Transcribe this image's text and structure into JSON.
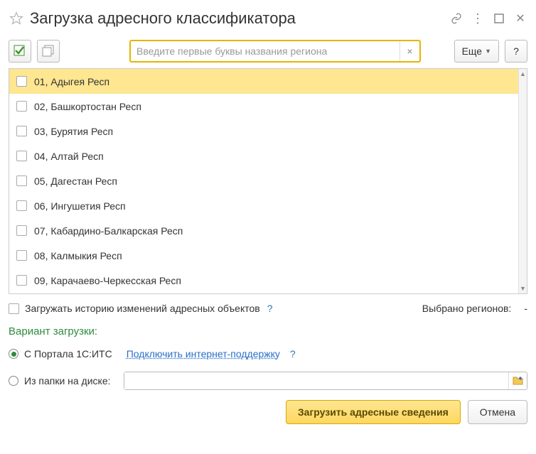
{
  "title": "Загрузка адресного классификатора",
  "search": {
    "placeholder": "Введите первые буквы названия региона"
  },
  "more_label": "Еще",
  "help_label": "?",
  "regions": [
    "01, Адыгея Респ",
    "02, Башкортостан Респ",
    "03, Бурятия Респ",
    "04, Алтай Респ",
    "05, Дагестан Респ",
    "06, Ингушетия Респ",
    "07, Кабардино-Балкарская Респ",
    "08, Калмыкия Респ",
    "09, Карачаево-Черкесская Респ"
  ],
  "history_label": "Загружать историю изменений адресных объектов",
  "selected_label": "Выбрано регионов:",
  "selected_value": "-",
  "variant_title": "Вариант загрузки:",
  "radio_portal": "С Портала 1С:ИТС",
  "link_support": "Подключить интернет-поддержку",
  "radio_folder": "Из папки на диске:",
  "btn_load": "Загрузить адресные сведения",
  "btn_cancel": "Отмена"
}
